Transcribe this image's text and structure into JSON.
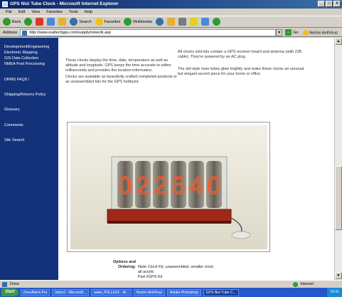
{
  "window": {
    "title": "GPS Nixi Tube Clock - Microsoft Internet Explorer"
  },
  "menu": [
    "File",
    "Edit",
    "View",
    "Favorites",
    "Tools",
    "Help"
  ],
  "toolbar": {
    "back": "Back",
    "search": "Search",
    "favorites": "Favorites",
    "multimedia": "Multimedia"
  },
  "address": {
    "label": "Address",
    "url": "http://www.realtechgps.com/supply/nixieclk.asp",
    "go": "Go",
    "extra": "Norton AntiVirus"
  },
  "sidebar": {
    "links": [
      "Development/Engineering",
      "Electronic Mapping",
      "GIS Data Collection",
      "NMEA Post Processing",
      "DRMS FAQS !",
      "Shipping/Returns Policy",
      "Glossary",
      "Comments",
      "Site Search"
    ]
  },
  "main": {
    "left_para1": "These clocks display the time, date, temperature as well as altitude and longitude. GPS keeps the time accurate to within milliseconds and provides the location information.",
    "left_para2": "Clocks are available as beautifully crafted completed products or as unassembled kits for the GPS hobbyist.",
    "right_para1": "All clocks sold kits contain a GPS receiver board and antenna (with 23ft. cable). They're powered by an AC plug.",
    "right_para2": "The old-style nixie tubes glow brightly and make these clocks an unusual but elegant accent piece for your home or office.",
    "clock_digits": [
      "0",
      "2",
      "2",
      "5",
      "4",
      "0"
    ],
    "options_label": "Options and Ordering:",
    "options_value1": "Nixie Clock Kit, unassembled, smaller clock",
    "options_value2": "all acrylic",
    "options_value3": "Part #GPS Kit"
  },
  "status": {
    "text": "Done",
    "zone": "Internet"
  },
  "taskbar": {
    "start": "Start",
    "tasks": [
      "ZoneAlarm Pro",
      "Inbox1 - Microsoft...",
      "www_POLLEX2 - M...",
      "Norton AntiVirus",
      "Adobe Photoshop",
      "GPS Nixi Tube C..."
    ],
    "clock": "10:41"
  },
  "colors": {
    "sidebar": "#13327a",
    "titlebar": "#0a246a",
    "taskbar": "#2457c9",
    "nixie": "#ff5a2a"
  }
}
